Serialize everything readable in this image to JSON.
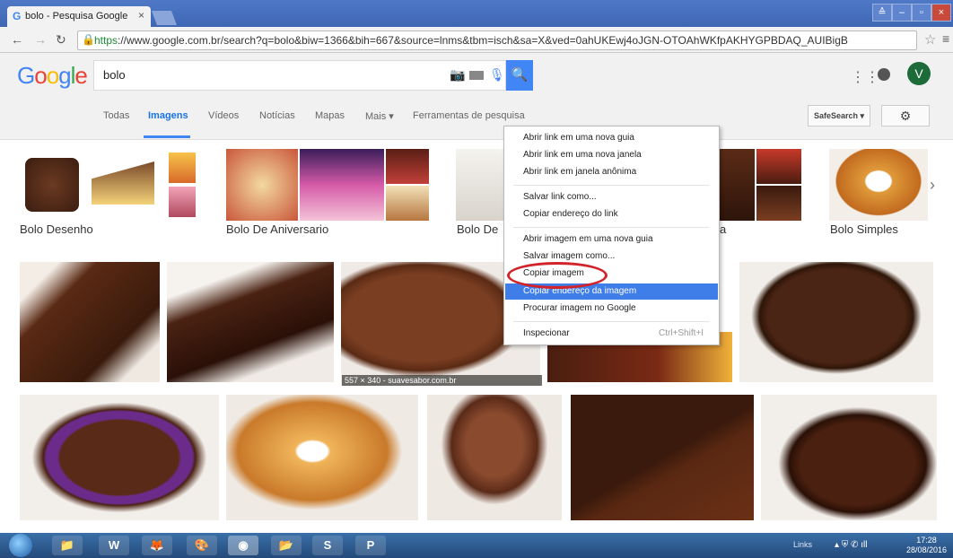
{
  "browser": {
    "tab_title": "bolo - Pesquisa Google",
    "tab_favicon": "G",
    "tab_close": "×",
    "url_scheme": "https",
    "url_rest": "://www.google.com.br/search?q=bolo&biw=1366&bih=667&source=lnms&tbm=isch&sa=X&ved=0ahUKEwj4oJGN-OTOAhWKfpAKHYGPBDAQ_AUIBigB",
    "window_buttons": [
      "≙",
      "–",
      "▫",
      "×"
    ]
  },
  "google": {
    "logo_letters": [
      "G",
      "o",
      "o",
      "g",
      "l",
      "e"
    ],
    "logo_colors": [
      "#4285f4",
      "#ea4335",
      "#fbbc05",
      "#4285f4",
      "#34a853",
      "#ea4335"
    ],
    "query": "bolo",
    "avatar_letter": "V",
    "tabs": [
      "Todas",
      "Imagens",
      "Vídeos",
      "Notícias",
      "Mapas",
      "Mais ▾",
      "Ferramentas de pesquisa"
    ],
    "safesearch": "SafeSearch ▾"
  },
  "related": [
    "Bolo Desenho",
    "Bolo De Aniversario",
    "Bolo De",
    "a",
    "Bolo Simples"
  ],
  "image_info": "557 × 340 - suavesabor.com.br",
  "context_menu": {
    "items": [
      "Abrir link em uma nova guia",
      "Abrir link em uma nova janela",
      "Abrir link em janela anônima",
      "Salvar link como...",
      "Copiar endereço do link",
      "Abrir imagem em uma nova guia",
      "Salvar imagem como...",
      "Copiar imagem",
      "Copiar endereço da imagem",
      "Procurar imagem no Google",
      "Inspecionar"
    ],
    "inspect_shortcut": "Ctrl+Shift+I"
  },
  "taskbar": {
    "links": "Links",
    "time": "17:28",
    "date": "28/08/2016"
  },
  "colors": {
    "accent": "#4285f4",
    "menu_highlight": "#3f7de8",
    "circle_annotation": "#d2232a",
    "avatar": "#1e6b3a"
  }
}
